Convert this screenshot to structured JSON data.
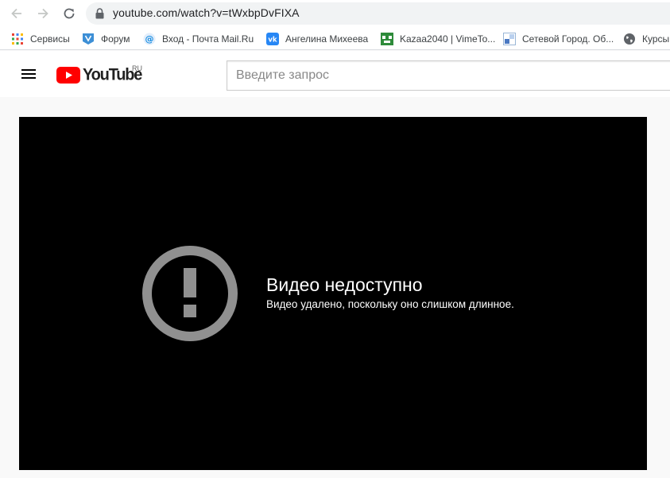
{
  "browser": {
    "url": "youtube.com/watch?v=tWxbpDvFIXA",
    "icons": [
      "back-icon",
      "forward-icon",
      "reload-icon",
      "lock-icon"
    ]
  },
  "bookmarks": [
    {
      "label": "Сервисы",
      "icon": "apps-grid-icon"
    },
    {
      "label": "Форум",
      "icon": "forum-icon"
    },
    {
      "label": "Вход - Почта Mail.Ru",
      "icon": "mailru-icon"
    },
    {
      "label": "Ангелина Михеева",
      "icon": "vk-icon"
    },
    {
      "label": "Kazaa2040 | VimeTo...",
      "icon": "vimetop-icon"
    },
    {
      "label": "Сетевой Город. Об...",
      "icon": "netcity-icon"
    },
    {
      "label": "Курсы",
      "icon": "globe-icon"
    }
  ],
  "youtube": {
    "logo_text": "YouTube",
    "region": "RU",
    "search_placeholder": "Введите запрос"
  },
  "player": {
    "error_title": "Видео недоступно",
    "error_reason": "Видео удалено, поскольку оно слишком длинное."
  },
  "colors": {
    "youtube_red": "#ff0000",
    "player_bg": "#000000",
    "error_icon": "#909090",
    "page_bg": "#f9f9f9"
  }
}
